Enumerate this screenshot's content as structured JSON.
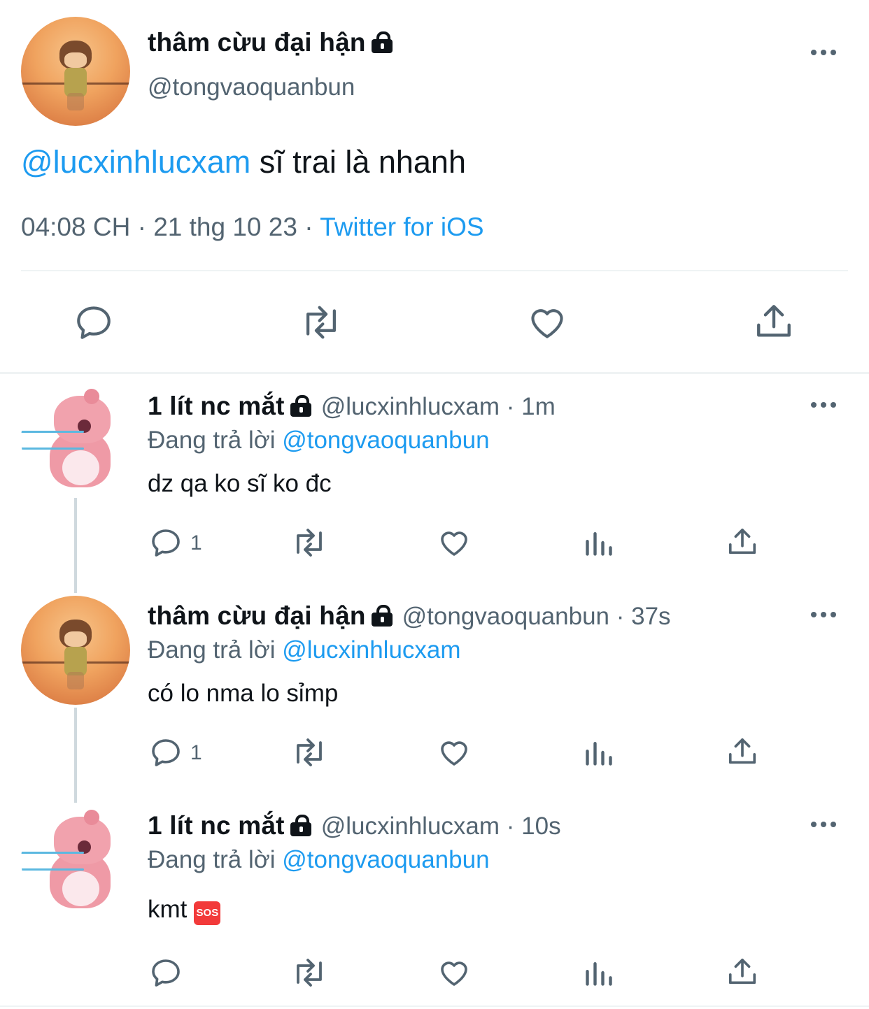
{
  "main_tweet": {
    "display_name": "thâm cừu đại hận",
    "handle": "@tongvaoquanbun",
    "mention": "@lucxinhlucxam",
    "text": " sĩ trai là nhanh",
    "timestamp": "04:08 CH · 21 thg 10 23 · ",
    "source": "Twitter for iOS",
    "icons": [
      "reply-icon",
      "retweet-icon",
      "like-icon",
      "share-icon"
    ]
  },
  "replies": [
    {
      "display_name": "1 lít nc mắt",
      "handle": "@lucxinhlucxam",
      "time": " · 1m",
      "replying_prefix": "Đang trả lời ",
      "replying_to": "@tongvaoquanbun",
      "text": "dz qa ko sĩ ko đc",
      "reply_count": "1"
    },
    {
      "display_name": "thâm cừu đại hận",
      "handle": "@tongvaoquanbun",
      "time": " · 37s",
      "replying_prefix": "Đang trả lời ",
      "replying_to": "@lucxinhlucxam",
      "text": "có lo nma lo sỉmp",
      "reply_count": "1"
    },
    {
      "display_name": "1 lít nc mắt",
      "handle": "@lucxinhlucxam",
      "time": " · 10s",
      "replying_prefix": "Đang trả lời ",
      "replying_to": "@tongvaoquanbun",
      "text": "kmt",
      "emoji": "SOS",
      "reply_count": ""
    }
  ],
  "colors": {
    "link": "#1d9bf0",
    "muted": "#536471",
    "text": "#0f1419",
    "divider": "#eff3f4"
  }
}
